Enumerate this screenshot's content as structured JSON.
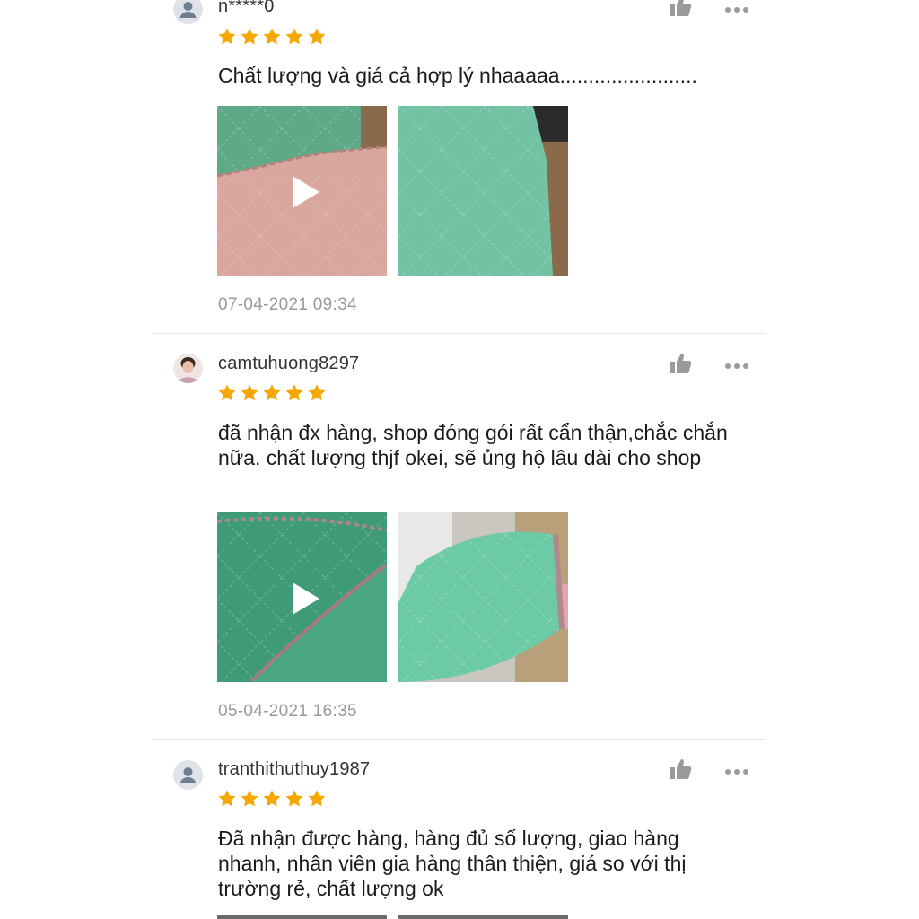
{
  "reviews": [
    {
      "username": "n*****0",
      "avatar": "default-user-icon",
      "rating": 5,
      "comment": "Chất lượng và giá cả hợp lý nhaaaaa........................",
      "media": [
        {
          "type": "video",
          "thumbnail": "pink-and-green-cloth"
        },
        {
          "type": "image",
          "thumbnail": "green-diamond-cloth"
        }
      ],
      "timestamp": "07-04-2021 09:34"
    },
    {
      "username": "camtuhuong8297",
      "avatar": "profile-photo",
      "rating": 5,
      "comment": "đã nhận đx hàng, shop đóng gói rất cẩn thận,chắc chắn nữa. chất lượng thjf okei, sẽ ủng hộ lâu dài cho shop",
      "media": [
        {
          "type": "video",
          "thumbnail": "green-cloth-closeup"
        },
        {
          "type": "image",
          "thumbnail": "green-cloth-packaged"
        }
      ],
      "timestamp": "05-04-2021 16:35"
    },
    {
      "username": "tranthithuthuy1987",
      "avatar": "default-user-icon",
      "rating": 5,
      "comment": "Đã nhận được hàng, hàng đủ số lượng, giao hàng nhanh, nhân viên gia hàng thân thiện, giá so với thị trường rẻ, chất lượng ok"
    }
  ],
  "icons": {
    "like": "thumbs-up-icon",
    "more": "more-options-icon",
    "star": "star-icon",
    "play": "play-icon"
  },
  "colors": {
    "star": "#f6a700",
    "icon_gray": "#9a9a9a",
    "timestamp": "#999999",
    "divider": "#e6e6e6"
  }
}
